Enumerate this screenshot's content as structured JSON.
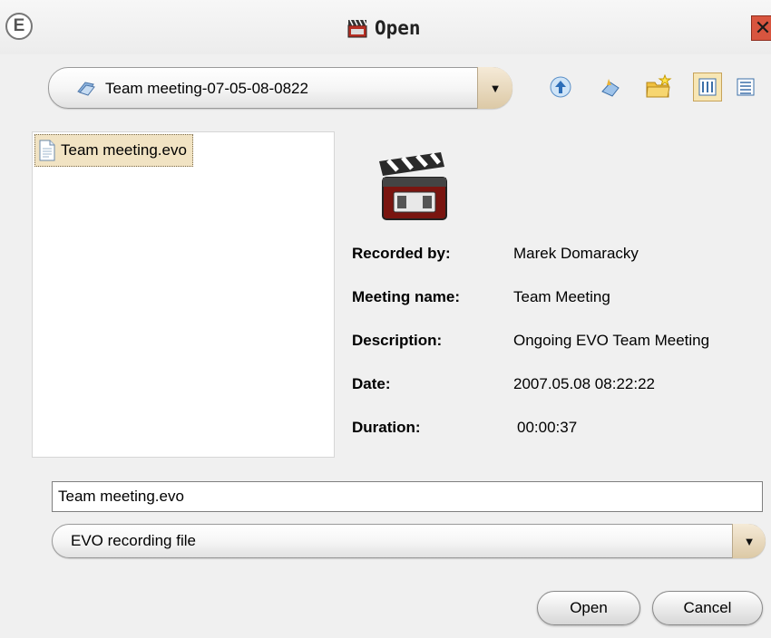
{
  "window": {
    "title": "Open",
    "app_logo": "E",
    "close_glyph": "✕"
  },
  "toolbar": {
    "path": "Team meeting-07-05-08-0822",
    "icons": [
      "up-folder-icon",
      "home-icon",
      "new-folder-icon",
      "list-view-icon",
      "details-view-icon"
    ]
  },
  "file_list": [
    {
      "name": "Team meeting.evo",
      "icon": "document-icon",
      "selected": true
    }
  ],
  "details": {
    "recorded_by": {
      "label": "Recorded by:",
      "value": "Marek Domaracky"
    },
    "meeting_name": {
      "label": "Meeting name:",
      "value": "Team Meeting"
    },
    "description": {
      "label": "Description:",
      "value": "Ongoing EVO Team Meeting"
    },
    "date": {
      "label": "Date:",
      "value": "2007.05.08 08:22:22"
    },
    "duration": {
      "label": "Duration:",
      "value": "00:00:37"
    }
  },
  "filename": "Team meeting.evo",
  "file_type": "EVO recording file",
  "buttons": {
    "open": "Open",
    "cancel": "Cancel"
  }
}
